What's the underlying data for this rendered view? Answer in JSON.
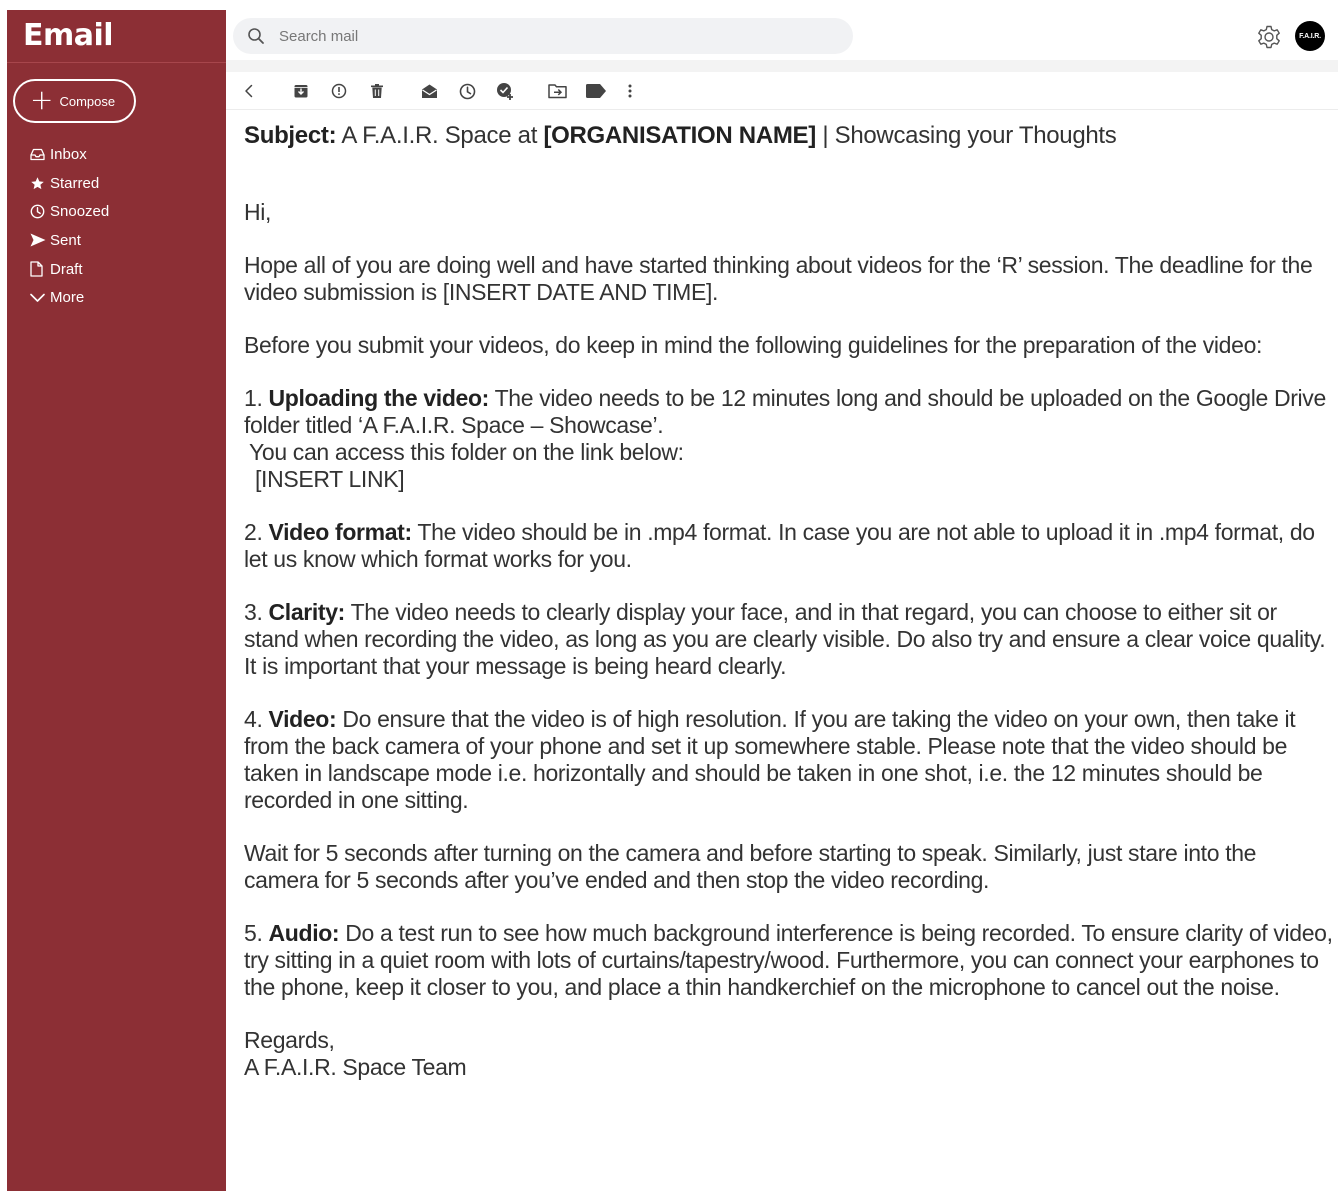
{
  "app": {
    "title": "Email"
  },
  "compose": {
    "label": "Compose"
  },
  "nav": [
    {
      "label": "Inbox",
      "icon": "inbox-icon"
    },
    {
      "label": "Starred",
      "icon": "star-icon"
    },
    {
      "label": "Snoozed",
      "icon": "clock-icon"
    },
    {
      "label": "Sent",
      "icon": "send-icon"
    },
    {
      "label": "Draft",
      "icon": "draft-icon"
    },
    {
      "label": "More",
      "icon": "chevron-down-icon"
    }
  ],
  "search": {
    "placeholder": "Search mail"
  },
  "account": {
    "avatar_text": "F.A.I.R."
  },
  "toolbar": {
    "icons": [
      "back-icon",
      "archive-icon",
      "report-spam-icon",
      "delete-icon",
      "mark-unread-icon",
      "snooze-icon",
      "add-task-icon",
      "move-to-icon",
      "label-icon",
      "more-vert-icon"
    ]
  },
  "email": {
    "subject_label": "Subject:",
    "subject_part1": "A F.A.I.R. Space at",
    "subject_org": "[ORGANISATION NAME]",
    "subject_part2": "| Showcasing your Thoughts",
    "greeting": "Hi,",
    "intro": "Hope all of you are doing well and have started thinking about videos for the ‘R’ session. The deadline for the video submission is [INSERT DATE AND TIME].",
    "guidelines_intro": "Before you submit your videos, do keep in mind the following guidelines for the preparation of the video:",
    "items": [
      {
        "num": "1.",
        "title": "Uploading the video:",
        "text": "The video needs to be 12 minutes long and should be uploaded on the Google Drive folder titled ‘A F.A.I.R. Space – Showcase’."
      },
      {
        "num": "2.",
        "title": "Video format:",
        "text": "The video should be in .mp4 format. In case you are not able to upload it in .mp4 format, do let us know which format works for you."
      },
      {
        "num": "3.",
        "title": "Clarity:",
        "text": "The video needs to clearly display your face, and in that regard, you can choose to either sit or stand when recording the video, as long as you are clearly visible. Do also try and ensure a clear voice quality. It is important that your message is being heard clearly."
      },
      {
        "num": "4.",
        "title": "Video:",
        "text": "Do ensure that the video is of high resolution. If you are taking the video on your own, then take it from the back camera of your phone and set it up somewhere stable. Please note that the video should be taken in landscape mode i.e. horizontally and should be taken in one shot, i.e. the 12 minutes should be recorded in one sitting."
      },
      {
        "num": "5.",
        "title": "Audio:",
        "text": "Do a test run to see how much background interference is being recorded. To ensure clarity of video, try sitting in a quiet room with lots of curtains/tapestry/wood. Furthermore, you can connect your earphones to the phone, keep it closer to you, and place a thin handkerchief on the microphone to cancel out the noise."
      }
    ],
    "access_line": "You can access this folder on the link below:",
    "link_placeholder": "[INSERT LINK]",
    "wait_note": "Wait for 5 seconds after turning on the camera and before starting to speak. Similarly, just stare into the camera for 5 seconds after you’ve ended and then stop the video recording.",
    "sign_off": "Regards,",
    "signature": "A F.A.I.R. Space Team"
  },
  "colors": {
    "sidebar": "#8c2f35",
    "search_bg": "#f1f2f4",
    "text": "#333333"
  }
}
